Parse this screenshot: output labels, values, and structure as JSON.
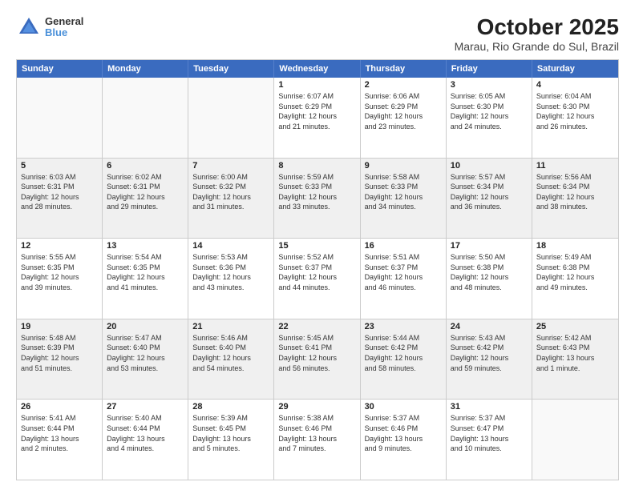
{
  "logo": {
    "general": "General",
    "blue": "Blue"
  },
  "title": "October 2025",
  "subtitle": "Marau, Rio Grande do Sul, Brazil",
  "weekdays": [
    "Sunday",
    "Monday",
    "Tuesday",
    "Wednesday",
    "Thursday",
    "Friday",
    "Saturday"
  ],
  "rows": [
    [
      {
        "day": "",
        "empty": true
      },
      {
        "day": "",
        "empty": true
      },
      {
        "day": "",
        "empty": true
      },
      {
        "day": "1",
        "info": "Sunrise: 6:07 AM\nSunset: 6:29 PM\nDaylight: 12 hours\nand 21 minutes."
      },
      {
        "day": "2",
        "info": "Sunrise: 6:06 AM\nSunset: 6:29 PM\nDaylight: 12 hours\nand 23 minutes."
      },
      {
        "day": "3",
        "info": "Sunrise: 6:05 AM\nSunset: 6:30 PM\nDaylight: 12 hours\nand 24 minutes."
      },
      {
        "day": "4",
        "info": "Sunrise: 6:04 AM\nSunset: 6:30 PM\nDaylight: 12 hours\nand 26 minutes."
      }
    ],
    [
      {
        "day": "5",
        "info": "Sunrise: 6:03 AM\nSunset: 6:31 PM\nDaylight: 12 hours\nand 28 minutes."
      },
      {
        "day": "6",
        "info": "Sunrise: 6:02 AM\nSunset: 6:31 PM\nDaylight: 12 hours\nand 29 minutes."
      },
      {
        "day": "7",
        "info": "Sunrise: 6:00 AM\nSunset: 6:32 PM\nDaylight: 12 hours\nand 31 minutes."
      },
      {
        "day": "8",
        "info": "Sunrise: 5:59 AM\nSunset: 6:33 PM\nDaylight: 12 hours\nand 33 minutes."
      },
      {
        "day": "9",
        "info": "Sunrise: 5:58 AM\nSunset: 6:33 PM\nDaylight: 12 hours\nand 34 minutes."
      },
      {
        "day": "10",
        "info": "Sunrise: 5:57 AM\nSunset: 6:34 PM\nDaylight: 12 hours\nand 36 minutes."
      },
      {
        "day": "11",
        "info": "Sunrise: 5:56 AM\nSunset: 6:34 PM\nDaylight: 12 hours\nand 38 minutes."
      }
    ],
    [
      {
        "day": "12",
        "info": "Sunrise: 5:55 AM\nSunset: 6:35 PM\nDaylight: 12 hours\nand 39 minutes."
      },
      {
        "day": "13",
        "info": "Sunrise: 5:54 AM\nSunset: 6:35 PM\nDaylight: 12 hours\nand 41 minutes."
      },
      {
        "day": "14",
        "info": "Sunrise: 5:53 AM\nSunset: 6:36 PM\nDaylight: 12 hours\nand 43 minutes."
      },
      {
        "day": "15",
        "info": "Sunrise: 5:52 AM\nSunset: 6:37 PM\nDaylight: 12 hours\nand 44 minutes."
      },
      {
        "day": "16",
        "info": "Sunrise: 5:51 AM\nSunset: 6:37 PM\nDaylight: 12 hours\nand 46 minutes."
      },
      {
        "day": "17",
        "info": "Sunrise: 5:50 AM\nSunset: 6:38 PM\nDaylight: 12 hours\nand 48 minutes."
      },
      {
        "day": "18",
        "info": "Sunrise: 5:49 AM\nSunset: 6:38 PM\nDaylight: 12 hours\nand 49 minutes."
      }
    ],
    [
      {
        "day": "19",
        "info": "Sunrise: 5:48 AM\nSunset: 6:39 PM\nDaylight: 12 hours\nand 51 minutes."
      },
      {
        "day": "20",
        "info": "Sunrise: 5:47 AM\nSunset: 6:40 PM\nDaylight: 12 hours\nand 53 minutes."
      },
      {
        "day": "21",
        "info": "Sunrise: 5:46 AM\nSunset: 6:40 PM\nDaylight: 12 hours\nand 54 minutes."
      },
      {
        "day": "22",
        "info": "Sunrise: 5:45 AM\nSunset: 6:41 PM\nDaylight: 12 hours\nand 56 minutes."
      },
      {
        "day": "23",
        "info": "Sunrise: 5:44 AM\nSunset: 6:42 PM\nDaylight: 12 hours\nand 58 minutes."
      },
      {
        "day": "24",
        "info": "Sunrise: 5:43 AM\nSunset: 6:42 PM\nDaylight: 12 hours\nand 59 minutes."
      },
      {
        "day": "25",
        "info": "Sunrise: 5:42 AM\nSunset: 6:43 PM\nDaylight: 13 hours\nand 1 minute."
      }
    ],
    [
      {
        "day": "26",
        "info": "Sunrise: 5:41 AM\nSunset: 6:44 PM\nDaylight: 13 hours\nand 2 minutes."
      },
      {
        "day": "27",
        "info": "Sunrise: 5:40 AM\nSunset: 6:44 PM\nDaylight: 13 hours\nand 4 minutes."
      },
      {
        "day": "28",
        "info": "Sunrise: 5:39 AM\nSunset: 6:45 PM\nDaylight: 13 hours\nand 5 minutes."
      },
      {
        "day": "29",
        "info": "Sunrise: 5:38 AM\nSunset: 6:46 PM\nDaylight: 13 hours\nand 7 minutes."
      },
      {
        "day": "30",
        "info": "Sunrise: 5:37 AM\nSunset: 6:46 PM\nDaylight: 13 hours\nand 9 minutes."
      },
      {
        "day": "31",
        "info": "Sunrise: 5:37 AM\nSunset: 6:47 PM\nDaylight: 13 hours\nand 10 minutes."
      },
      {
        "day": "",
        "empty": true
      }
    ]
  ]
}
